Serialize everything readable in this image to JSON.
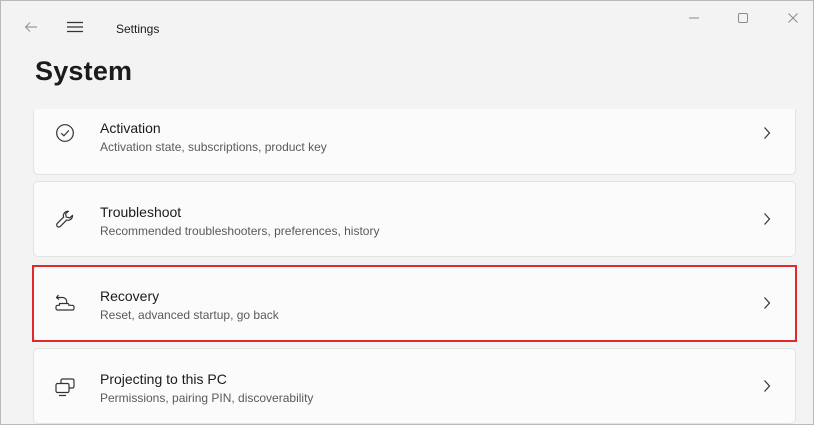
{
  "titlebar": {
    "app_title": "Settings",
    "back_icon": "back-arrow-icon",
    "menu_icon": "hamburger-menu-icon",
    "minimize_icon": "minimize-icon",
    "maximize_icon": "maximize-icon",
    "close_icon": "close-icon"
  },
  "page": {
    "title": "System"
  },
  "items": [
    {
      "icon": "activation-check-icon",
      "title": "Activation",
      "subtitle": "Activation state, subscriptions, product key"
    },
    {
      "icon": "wrench-icon",
      "title": "Troubleshoot",
      "subtitle": "Recommended troubleshooters, preferences, history"
    },
    {
      "icon": "recovery-icon",
      "title": "Recovery",
      "subtitle": "Reset, advanced startup, go back",
      "highlighted": true
    },
    {
      "icon": "projecting-icon",
      "title": "Projecting to this PC",
      "subtitle": "Permissions, pairing PIN, discoverability"
    }
  ],
  "colors": {
    "window_bg": "#f3f3f3",
    "card_bg": "#fbfbfb",
    "card_border": "#e3e3e3",
    "highlight": "#e02a2a",
    "text_primary": "#1b1b1b",
    "text_secondary": "#5a5a5a"
  }
}
